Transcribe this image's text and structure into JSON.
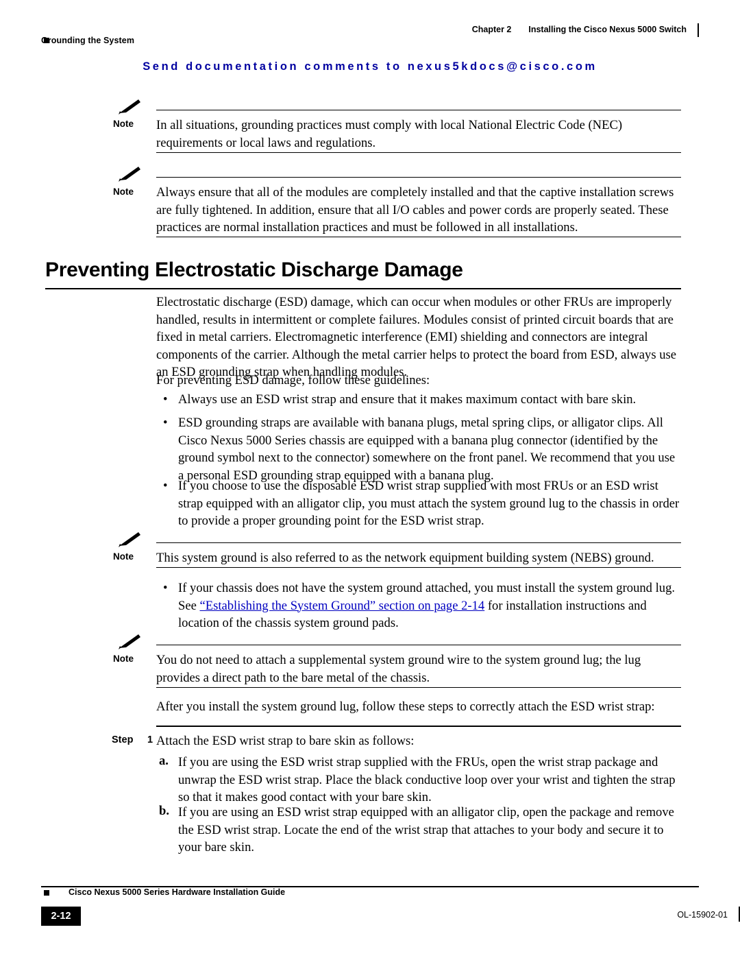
{
  "header": {
    "chapter_label": "Chapter 2",
    "chapter_title": "Installing the Cisco Nexus 5000 Switch",
    "section_title": "Grounding the System"
  },
  "banner": {
    "text": "Send documentation comments to nexus5kdocs@cisco.com",
    "color": "#0000a0"
  },
  "notes": [
    {
      "label": "Note",
      "text": "In all situations, grounding practices must comply with local National Electric Code (NEC) requirements or local laws and regulations."
    },
    {
      "label": "Note",
      "text": "Always ensure that all of the modules are completely installed and that the captive installation screws are fully tightened. In addition, ensure that all I/O cables and power cords are properly seated. These practices are normal installation practices and must be followed in all installations."
    },
    {
      "label": "Note",
      "text": "This system ground is also referred to as the network equipment building system (NEBS) ground."
    },
    {
      "label": "Note",
      "text": "You do not need to attach a supplemental system ground wire to the system ground lug; the lug provides a direct path to the bare metal of the chassis."
    }
  ],
  "heading": "Preventing Electrostatic Discharge Damage",
  "paragraphs": {
    "intro": "Electrostatic discharge (ESD) damage, which can occur when modules or other FRUs are improperly handled, results in intermittent or complete failures. Modules consist of printed circuit boards that are fixed in metal carriers. Electromagnetic interference (EMI) shielding and connectors are integral components of the carrier. Although the metal carrier helps to protect the board from ESD, always use an ESD grounding strap when handling modules.",
    "guidelines_lead": "For preventing ESD damage, follow these guidelines:",
    "after_lug": "After you install the system ground lug, follow these steps to correctly attach the ESD wrist strap:"
  },
  "bullets": [
    "Always use an ESD wrist strap and ensure that it makes maximum contact with bare skin.",
    "ESD grounding straps are available with banana plugs, metal spring clips, or alligator clips. All Cisco Nexus 5000 Series chassis are equipped with a banana plug connector (identified by the ground symbol next to the connector) somewhere on the front panel. We recommend that you use a personal ESD grounding strap equipped with a banana plug."
  ],
  "bullet3": {
    "text": "If you choose to use the disposable ESD wrist strap supplied with most FRUs or an ESD wrist strap equipped with an alligator clip, you must attach the system ground lug to the chassis in order to provide a proper grounding point for the ESD wrist strap."
  },
  "bullet4": {
    "line1_pre": "If your chassis does not have the system ground attached, you must install the system ground lug.",
    "line2_pre": "See ",
    "link": "“Establishing the System Ground” section on page 2-14",
    "line2_post": " for installation instructions and",
    "line3": "location of the chassis system ground pads."
  },
  "step": {
    "label": "Step",
    "number": "1",
    "text": "Attach the ESD wrist strap to bare skin as follows:",
    "substeps": [
      {
        "letter": "a.",
        "text": "If you are using the ESD wrist strap supplied with the FRUs, open the wrist strap package and unwrap the ESD wrist strap. Place the black conductive loop over your wrist and tighten the strap so that it makes good contact with your bare skin."
      },
      {
        "letter": "b.",
        "text": "If you are using an ESD wrist strap equipped with an alligator clip, open the package and remove the ESD wrist strap. Locate the end of the wrist strap that attaches to your body and secure it to your bare skin."
      }
    ]
  },
  "footer": {
    "guide_title": "Cisco Nexus 5000 Series Hardware Installation Guide",
    "page_number": "2-12",
    "doc_id": "OL-15902-01"
  }
}
